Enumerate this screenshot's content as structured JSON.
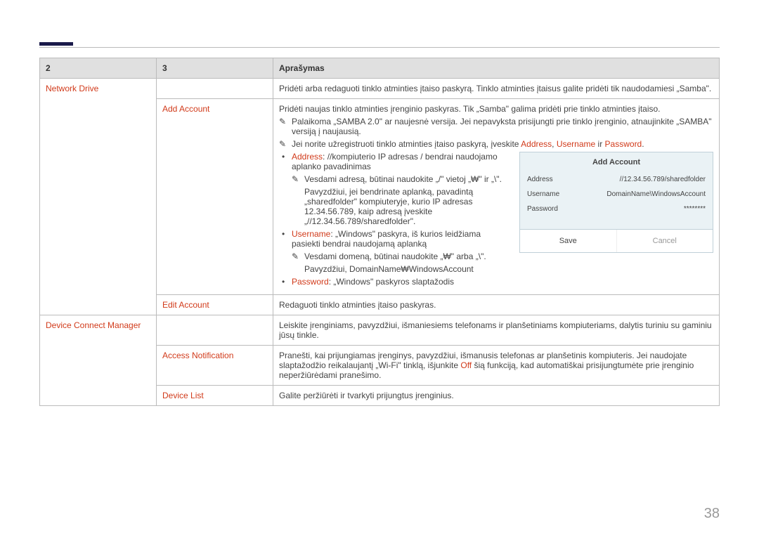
{
  "header": {
    "col1": "2",
    "col2": "3",
    "col3": "Aprašymas"
  },
  "rows": {
    "networkDrive": {
      "label": "Network Drive",
      "desc": "Pridėti arba redaguoti tinklo atminties įtaiso paskyrą. Tinklo atminties įtaisus galite pridėti tik naudodamiesi „Samba\"."
    },
    "addAccount": {
      "label": "Add Account",
      "desc1": "Pridėti naujas tinklo atminties įrenginio paskyras. Tik „Samba\" galima pridėti prie tinklo atminties įtaiso.",
      "note1": "Palaikoma „SAMBA 2.0\" ar naujesnė versija. Jei nepavyksta prisijungti prie tinklo įrenginio, atnaujinkite „SAMBA\" versiją į naujausią.",
      "note2a": "Jei norite užregistruoti tinklo atminties įtaiso paskyrą, įveskite ",
      "note2_addr": "Address",
      "note2_sep1": ", ",
      "note2_user": "Username",
      "note2_sep2": " ir ",
      "note2_pass": "Password",
      "note2_end": ".",
      "addressLabel": "Address",
      "addressDesc": ": //kompiuterio IP adresas / bendrai naudojamo aplanko pavadinimas",
      "addrSub1": "Vesdami adresą, būtinai naudokite „/\" vietoj „₩\" ir „\\\".",
      "addrSub2": "Pavyzdžiui, jei bendrinate aplanką, pavadintą „sharedfolder\" kompiuteryje, kurio IP adresas 12.34.56.789, kaip adresą įveskite „//12.34.56.789/sharedfolder\".",
      "usernameLabel": "Username",
      "usernameDesc": ": „Windows\" paskyra, iš kurios leidžiama pasiekti bendrai naudojamą aplanką",
      "userSub1": "Vesdami domeną, būtinai naudokite „₩\" arba „\\\".",
      "userSub2": "Pavyzdžiui, DomainName₩WindowsAccount",
      "passwordLabel": "Password",
      "passwordDesc": ": „Windows\" paskyros slaptažodis"
    },
    "editAccount": {
      "label": "Edit Account",
      "desc": "Redaguoti tinklo atminties įtaiso paskyras."
    },
    "dcm": {
      "label": "Device Connect Manager",
      "desc": "Leiskite įrenginiams, pavyzdžiui, išmaniesiems telefonams ir planšetiniams kompiuteriams, dalytis turiniu su gaminiu jūsų tinkle."
    },
    "accessNotif": {
      "label": "Access Notification",
      "desc1": "Pranešti, kai prijungiamas įrenginys, pavyzdžiui, išmanusis telefonas ar planšetinis kompiuteris. Jei naudojate slaptažodžio reikalaujantį „Wi-Fi\" tinklą, išjunkite ",
      "off": "Off",
      "desc2": " šią funkciją, kad automatiškai prisijungtumėte prie įrenginio neperžiūrėdami pranešimo."
    },
    "deviceList": {
      "label": "Device List",
      "desc": "Galite peržiūrėti ir tvarkyti prijungtus įrenginius."
    }
  },
  "floatBox": {
    "title": "Add Account",
    "addressLbl": "Address",
    "addressVal": "//12.34.56.789/sharedfolder",
    "userLbl": "Username",
    "userVal": "DomainName\\WindowsAccount",
    "passLbl": "Password",
    "passVal": "********",
    "save": "Save",
    "cancel": "Cancel"
  },
  "pageNum": "38"
}
